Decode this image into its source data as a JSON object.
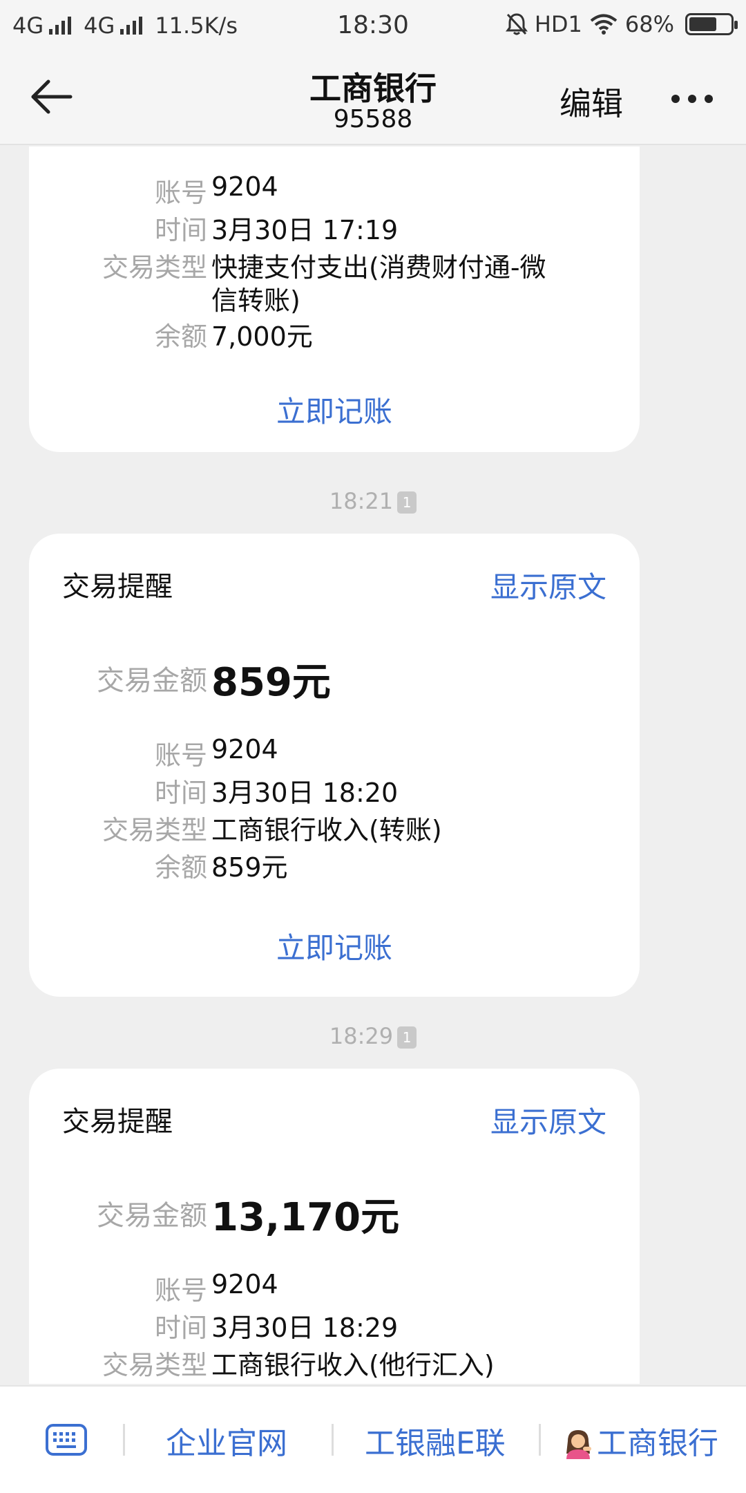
{
  "status_bar": {
    "net1": "4G",
    "net2": "4G",
    "speed": "11.5K/s",
    "time": "18:30",
    "hd": "HD1",
    "battery": "68%",
    "battery_level": 0.68
  },
  "header": {
    "title": "工商银行",
    "number": "95588",
    "edit_label": "编辑"
  },
  "labels": {
    "amount": "交易金额",
    "account": "账号",
    "time": "时间",
    "type": "交易类型",
    "balance": "余额",
    "record": "立即记账",
    "show_raw": "显示原文",
    "card_title": "交易提醒"
  },
  "messages": [
    {
      "account": "9204",
      "time": "3月30日 17:19",
      "type": "快捷支付支出(消费财付通-微信转账)",
      "type_line1": "快捷支付支出(消费财付通-微",
      "type_line2": "信转账)",
      "balance": "7,000元"
    },
    {
      "timestamp": "18:21",
      "badge": "1",
      "amount": "859元",
      "account": "9204",
      "time": "3月30日 18:20",
      "type": "工商银行收入(转账)",
      "balance": "859元"
    },
    {
      "timestamp": "18:29",
      "badge": "1",
      "amount": "13,170元",
      "account": "9204",
      "time": "3月30日 18:29",
      "type": "工商银行收入(他行汇入)"
    }
  ],
  "bottom_menu": {
    "item1": "企业官网",
    "item2": "工银融E联",
    "item3": "工商银行"
  }
}
